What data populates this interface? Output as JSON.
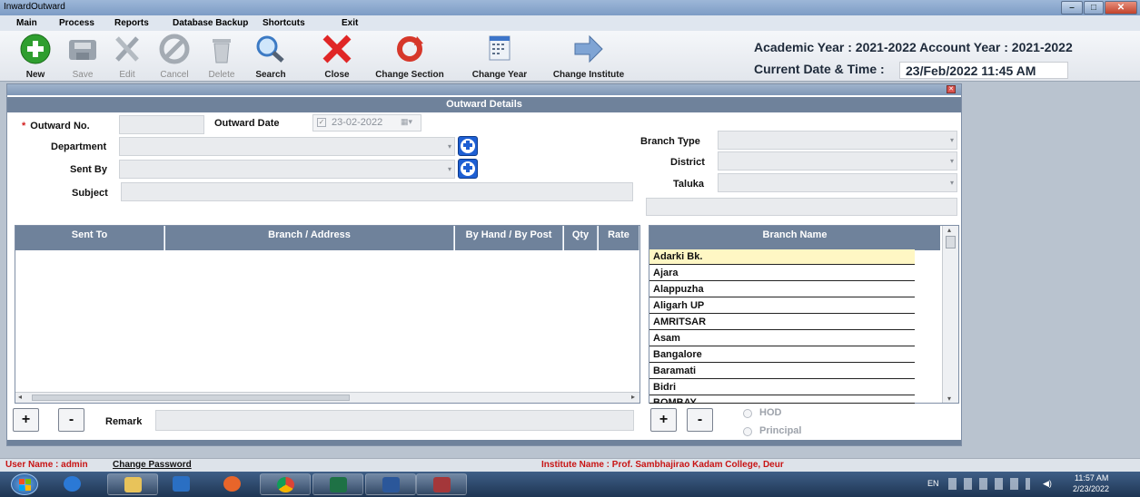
{
  "window": {
    "title": "InwardOutward"
  },
  "menu": [
    "Main",
    "Process",
    "Reports",
    "Database Backup",
    "Shortcuts",
    "Exit"
  ],
  "toolbar": {
    "new": "New",
    "save": "Save",
    "edit": "Edit",
    "cancel": "Cancel",
    "delete": "Delete",
    "search": "Search",
    "close": "Close",
    "change_section": "Change Section",
    "change_year": "Change Year",
    "change_institute": "Change Institute"
  },
  "header": {
    "year_line": "Academic Year : 2021-2022 Account Year : 2021-2022",
    "datetime_label": "Current Date & Time :",
    "datetime_value": "23/Feb/2022 11:45 AM"
  },
  "form": {
    "section_title": "Outward Details",
    "outward_no_label": "Outward No.",
    "outward_no_value": "",
    "outward_date_label": "Outward Date",
    "outward_date_value": "23-02-2022",
    "department_label": "Department",
    "sent_by_label": "Sent By",
    "subject_label": "Subject",
    "branch_type_label": "Branch Type",
    "district_label": "District",
    "taluka_label": "Taluka",
    "remark_label": "Remark"
  },
  "grid": {
    "columns": [
      "Sent To",
      "Branch / Address",
      "By Hand / By Post",
      "Qty",
      "Rate"
    ]
  },
  "branch": {
    "header": "Branch Name",
    "items": [
      "Adarki Bk.",
      "Ajara",
      "Alappuzha",
      "Aligarh UP",
      "AMRITSAR",
      "Asam",
      "Bangalore",
      "Baramati",
      "Bidri",
      "BOMBAY"
    ]
  },
  "options": {
    "hod": "HOD",
    "principal": "Principal"
  },
  "buttons": {
    "plus": "+",
    "minus": "-"
  },
  "status": {
    "user": "User Name : admin",
    "change_password": "Change Password",
    "institute": "Institute Name : Prof. Sambhajirao Kadam College, Deur"
  },
  "taskbar": {
    "lang": "EN",
    "time": "11:57 AM",
    "date": "2/23/2022"
  },
  "colors": {
    "section_bar": "#6f829b",
    "required": "#d21d1d",
    "selected_row": "#fff7c4",
    "plus_button": "#1e5fd3"
  }
}
